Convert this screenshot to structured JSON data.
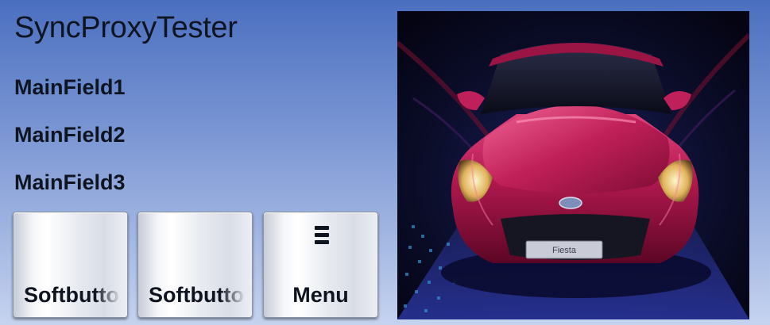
{
  "app": {
    "title": "SyncProxyTester"
  },
  "main_fields": [
    {
      "text": "MainField1"
    },
    {
      "text": "MainField2"
    },
    {
      "text": "MainField3"
    }
  ],
  "softbuttons": [
    {
      "label": "Softbutton",
      "icon": null
    },
    {
      "label": "Softbutton",
      "icon": null
    },
    {
      "label": "Menu",
      "icon": "menu-icon"
    }
  ],
  "graphic": {
    "subject": "red hatchback car front view",
    "plate_text": "Fiesta"
  },
  "colors": {
    "background_top": "#4b6fc0",
    "background_bottom": "#c5d3ef",
    "text": "#0f1520",
    "car_body": "#b0184e"
  }
}
